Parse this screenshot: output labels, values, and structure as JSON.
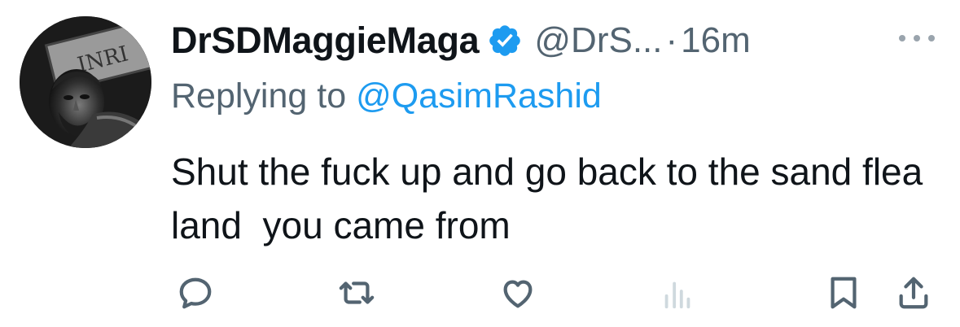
{
  "tweet": {
    "display_name": "DrSDMaggieMaga",
    "handle": "@DrS...",
    "separator": "·",
    "time": "16m",
    "reply_prefix": "Replying to ",
    "reply_mention": "@QasimRashid",
    "text": "Shut the fuck up and go back to the sand flea land  you came from",
    "verified_color": "#1d9bf0"
  },
  "icons": {
    "avatar": "avatar-image",
    "verified": "verified-badge-icon",
    "more": "more-options-icon",
    "reply": "reply-icon",
    "retweet": "retweet-icon",
    "like": "like-icon",
    "views": "views-icon",
    "bookmark": "bookmark-icon",
    "share": "share-icon"
  }
}
